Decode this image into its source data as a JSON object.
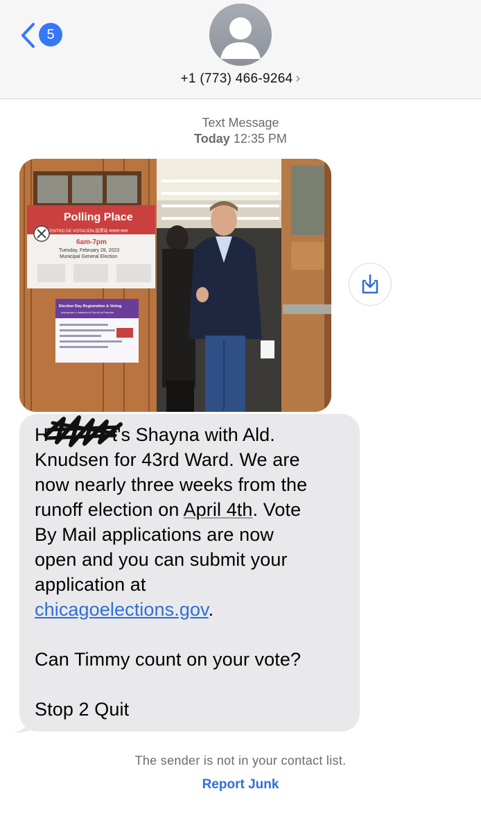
{
  "header": {
    "unread_count": "5",
    "contact_number": "+1 (773) 466-9264",
    "contact_chevron": "›"
  },
  "thread": {
    "service_label": "Text Message",
    "day_label": "Today",
    "time_label": "12:35 PM"
  },
  "photo": {
    "sign_title": "Polling Place",
    "sign_subtitle": "CENTRO DE VOTACIÓN 投票站 मतदान स्थल",
    "sign_hours": "6am-7pm",
    "sign_date": "Tuesday, February 28, 2023",
    "sign_election": "Municipal General Election",
    "notice_title": "Election Day Registration & Voting",
    "notice_subtitle": "Inscripción y Votación el Día de la Elección"
  },
  "message": {
    "line1_start": "H",
    "line1_rest": "t's Shayna with Ald.",
    "line2": "Knudsen for 43rd Ward. We are",
    "line3": "now nearly three weeks from the",
    "line4_start": "runoff election on ",
    "line4_date": "April 4th",
    "line4_end": ". Vote",
    "line5": "By Mail applications are now",
    "line6": "open and you can submit your",
    "line7": "application at",
    "line8_link": "chicagoelections.gov",
    "line8_end": ".",
    "line9": "Can Timmy count on your vote?",
    "line10": "Stop 2 Quit"
  },
  "footer": {
    "unknown_sender_note": "The sender is not in your contact list.",
    "report_junk_label": "Report Junk"
  },
  "colors": {
    "accent": "#3478f6",
    "link": "#2f6fd6",
    "bubble": "#e9e9eb",
    "header_bg": "#f6f6f6"
  },
  "icons": [
    "back-chevron-icon",
    "contact-avatar-icon",
    "save-download-icon"
  ]
}
